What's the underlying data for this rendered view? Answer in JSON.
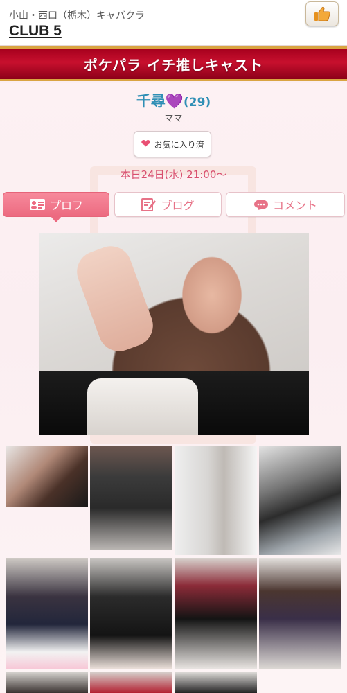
{
  "header": {
    "area": "小山・西口（栃木）キャバクラ",
    "shop_name": "CLUB 5",
    "like_icon": "thumbs-up-icon"
  },
  "banner": {
    "title": "ポケパラ イチ推しキャスト"
  },
  "cast": {
    "name": "千尋",
    "emoji": "💜",
    "age": "(29)",
    "role": "ママ"
  },
  "favorite": {
    "label": "お気に入り済",
    "icon": "heart-icon"
  },
  "schedule": "本日24日(水) 21:00〜",
  "tabs": [
    {
      "label": "プロフ",
      "icon": "profile-card-icon",
      "active": true
    },
    {
      "label": "ブログ",
      "icon": "blog-edit-icon",
      "active": false
    },
    {
      "label": "コメント",
      "icon": "speech-bubble-icon",
      "active": false
    }
  ],
  "colors": {
    "accent": "#ec6a80",
    "banner": "#c8102e",
    "name": "#2f8fb5",
    "schedule": "#d84f6f"
  },
  "gallery": {
    "visible_thumbnails": 11
  }
}
